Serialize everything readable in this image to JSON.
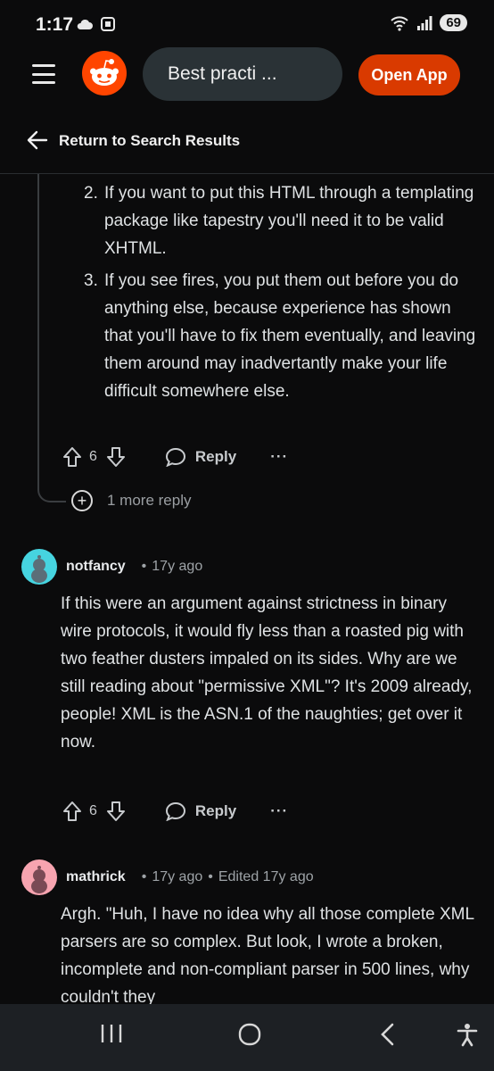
{
  "status": {
    "time": "1:17",
    "battery": "69"
  },
  "header": {
    "search_text": "Best practi ...",
    "open_app_label": "Open App"
  },
  "nav": {
    "return_label": "Return to Search Results"
  },
  "prev_comment": {
    "items": [
      {
        "num": "2.",
        "text": "If you want to put this HTML through a templating package like tapestry you'll need it to be valid XHTML."
      },
      {
        "num": "3.",
        "text": "If you see fires, you put them out before you do anything else, because experience has shown that you'll have to fix them eventually, and leaving them around may inadvertantly make your life difficult somewhere else."
      }
    ],
    "votes": "6",
    "reply_label": "Reply",
    "more_replies": "1 more reply"
  },
  "comments": [
    {
      "author": "notfancy",
      "age": "17y ago",
      "edited": "",
      "avatar_color": "#46d4e0",
      "body": "If this were an argument against strictness in binary wire protocols, it would fly less than a roasted pig with two feather dusters impaled on its sides. Why are we still reading about \"permissive XML\"? It's 2009 already, people! XML is the ASN.1 of the naughties; get over it now.",
      "votes": "6",
      "reply_label": "Reply"
    },
    {
      "author": "mathrick",
      "age": "17y ago",
      "edited": "Edited 17y ago",
      "avatar_color": "#f7a4b0",
      "body": "Argh. \"Huh, I have no idea why all those complete XML parsers are so complex. But look, I wrote a broken, incomplete and non-compliant parser in 500 lines, why couldn't they"
    }
  ],
  "colors": {
    "accent": "#ff4500",
    "open_app": "#d93a00",
    "background": "#0b0b0c"
  }
}
